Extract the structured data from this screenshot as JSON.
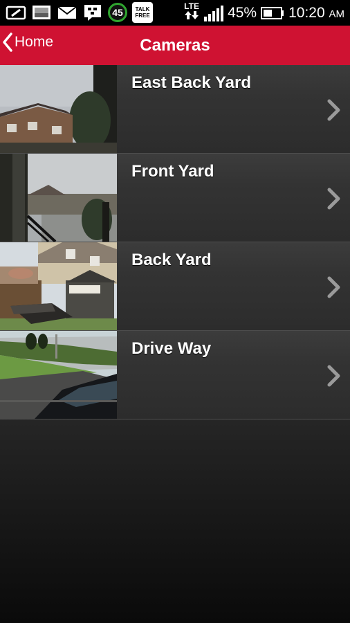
{
  "status_bar": {
    "notification_badge": "45",
    "talk_free_line1": "TALK",
    "talk_free_line2": "FREE",
    "network": "LTE",
    "battery": "45%",
    "time": "10:20",
    "ampm": "AM",
    "icons": [
      "nfc-icon",
      "image-icon",
      "mail-icon",
      "bbm-icon",
      "badge-45-icon",
      "talkfree-icon",
      "lte-icon",
      "signal-icon",
      "battery-icon"
    ]
  },
  "header": {
    "back_label": "Home",
    "title": "Cameras",
    "color": "#cf1232"
  },
  "cameras": [
    {
      "name": "East Back Yard",
      "thumbnail": "east-back-yard-thumbnail"
    },
    {
      "name": "Front Yard",
      "thumbnail": "front-yard-thumbnail"
    },
    {
      "name": "Back Yard",
      "thumbnail": "back-yard-thumbnail"
    },
    {
      "name": "Drive Way",
      "thumbnail": "drive-way-thumbnail"
    }
  ]
}
